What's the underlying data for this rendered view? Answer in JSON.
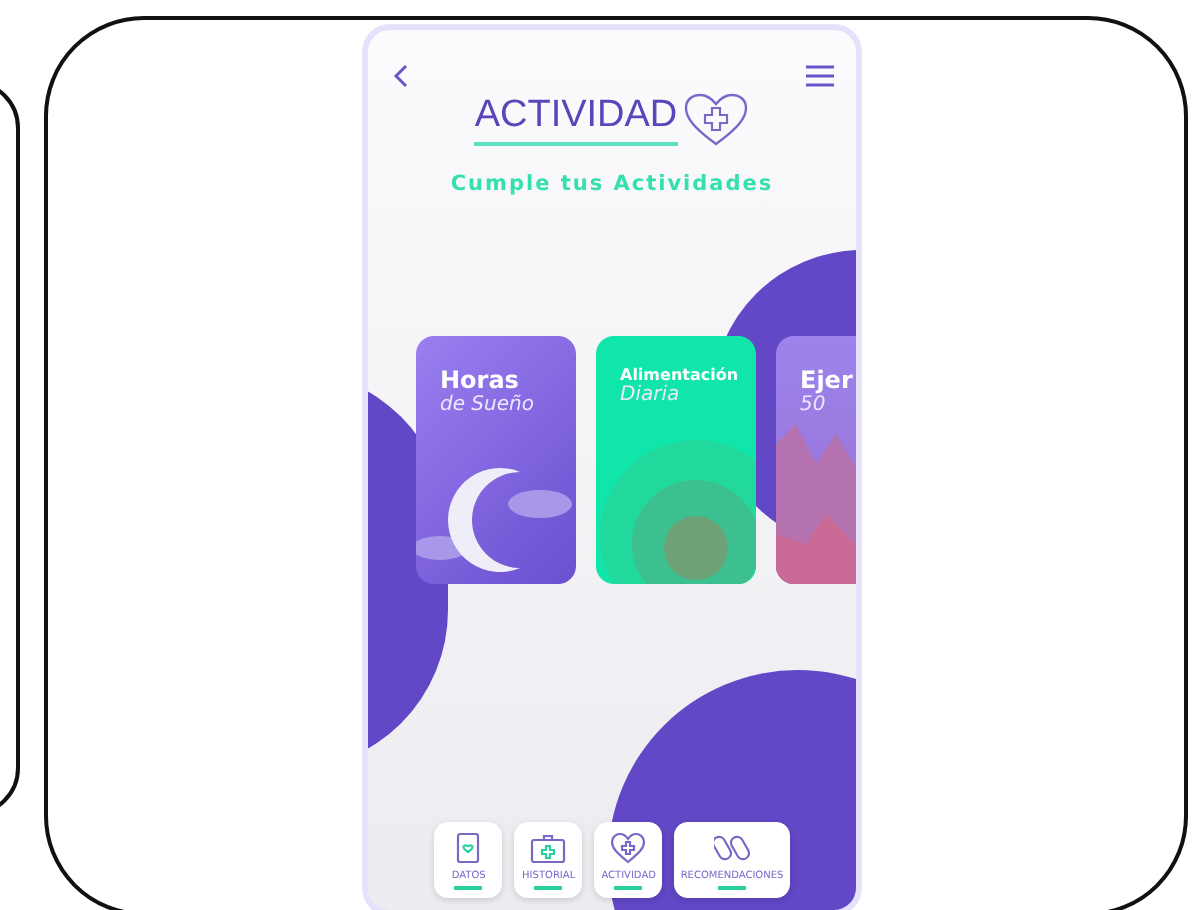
{
  "header": {
    "title": "ACTIVIDAD",
    "subtitle": "Cumple tus Actividades"
  },
  "cards": [
    {
      "kind": "moon",
      "title": "Horas",
      "subtitle": "de Sueño"
    },
    {
      "kind": "circles",
      "title": "Alimentación",
      "subtitle": "Diaria"
    },
    {
      "kind": "mountains",
      "title": "Ejer",
      "subtitle": "50"
    }
  ],
  "nav": [
    {
      "kind": "clipboard",
      "label": "DATOS"
    },
    {
      "kind": "kit",
      "label": "HISTORIAL"
    },
    {
      "kind": "heart",
      "label": "ACTIVIDAD"
    },
    {
      "kind": "pills",
      "label": "RECOMENDACIONES"
    }
  ]
}
